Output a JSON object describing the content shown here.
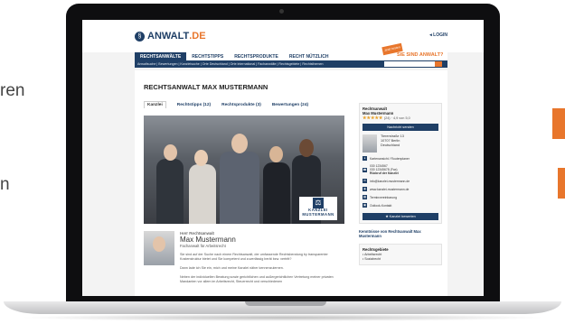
{
  "background": {
    "text_1": "ren",
    "text_2": "n",
    "accent": "#e8762c"
  },
  "site": {
    "logo": {
      "mark": "§",
      "name": "ANWALT",
      "tld": ".DE"
    },
    "login": "LOGIN",
    "nav": [
      "RECHTSANWÄLTE",
      "RECHTSTIPPS",
      "RECHTSPRODUKTE",
      "RECHT NÜTZLICH"
    ],
    "cta": "SIE SIND ANWALT?",
    "cta_badge": "Jetzt testen",
    "subnav": "Anwaltsuche | Bewertungen | Kanzleisuche | Orte Deutschland | Orte international | Fachanwälte | Rechtsgebiete | Rechtsthemen",
    "title": "RECHTSANWALT MAX MUSTERMANN",
    "tabs": [
      "Kanzlei",
      "Rechtstipps (12)",
      "Rechtsprodukte (3)",
      "Bewertungen (24)"
    ],
    "brand": {
      "line1": "KANZLEI",
      "line2": "MUSTERMANN"
    },
    "bio": {
      "salutation": "Herr Rechtsanwalt",
      "name": "Max Mustermann",
      "subtitle": "Fachanwalt für Arbeitsrecht",
      "p1": "Sie sind auf der Suche nach einem Rechtsanwalt, der umfassende Rechtsberatung by transparenter Kostenstruktur bietet und Sie kompetent und zuverlässig berät bzw. vertritt?",
      "p2": "Dann lade ich Sie ein, mich und meine Kanzlei näher kennenzulernen.",
      "p3": "Neben der individuellen Beratung sowie gerichtlichen und außergerichtlichen Vertretung meiner privaten Mandanten vor allem im Arbeitsrecht, Steuerrecht und verschiedenen"
    },
    "sidebar": {
      "name1": "Rechtsanwalt",
      "name2": "Max Mustermann",
      "stars": "★★★★★",
      "rating": "(24) · 4,9 von 5,0",
      "message_btn": "Nachricht senden",
      "address": [
        "Tiererstraße 13",
        "10707 Berlin",
        "Deutschland"
      ],
      "contacts": [
        "Kartenansicht / Routenplaner",
        "030 1234567",
        "030 12345678 (Fax)",
        "Rückruf der Kanzlei",
        "info@kanzlei-mustermann.de",
        "www.kanzlei-mustermann.de",
        "Terminvereinbarung",
        "Outlook-Kontakt"
      ],
      "rate_btn": "Kanzlei bewerten",
      "knowledge": "Kenntnisse von Rechtsanwalt Max Mustermann",
      "areas_title": "Rechtsgebiete",
      "areas": [
        "Arbeitsrecht",
        "Sozialrecht"
      ]
    }
  }
}
